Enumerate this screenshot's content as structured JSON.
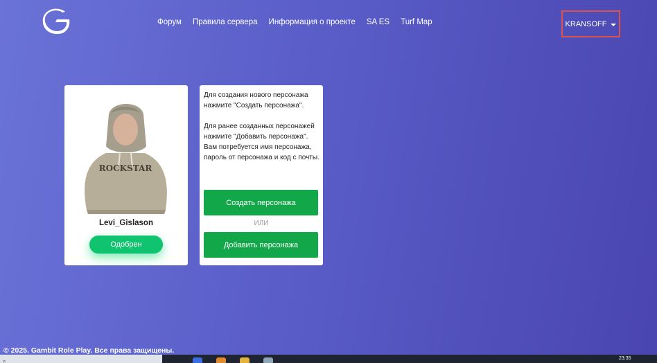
{
  "header": {
    "nav": [
      {
        "label": "Форум"
      },
      {
        "label": "Правила сервера"
      },
      {
        "label": "Информация о проекте"
      },
      {
        "label": "SA ES"
      },
      {
        "label": "Turf Map"
      }
    ],
    "user": {
      "name": "KRANSOFF"
    }
  },
  "character": {
    "name": "Levi_Gislason",
    "status": "Одобрен",
    "hoodie_text": "ROCKSTAR"
  },
  "info": {
    "text": "Для создания нового персонажа нажмите \"Создать персонажа\".\n\nДля ранее созданных персонажей нажмите \"Добавить персонажа\". Вам потребуется имя персонажа, пароль от персонажа и код с почты.",
    "create_button": "Создать персонажа",
    "or_label": "ИЛИ",
    "add_button": "Добавить персонажа"
  },
  "footer": {
    "copyright": "© 2025. Gambit Role Play. Все права защищены."
  },
  "taskbar": {
    "time": "23:35"
  },
  "colors": {
    "accent_green": "#12a84a",
    "status_green": "#10c36e",
    "highlight_red": "#d9534f"
  }
}
